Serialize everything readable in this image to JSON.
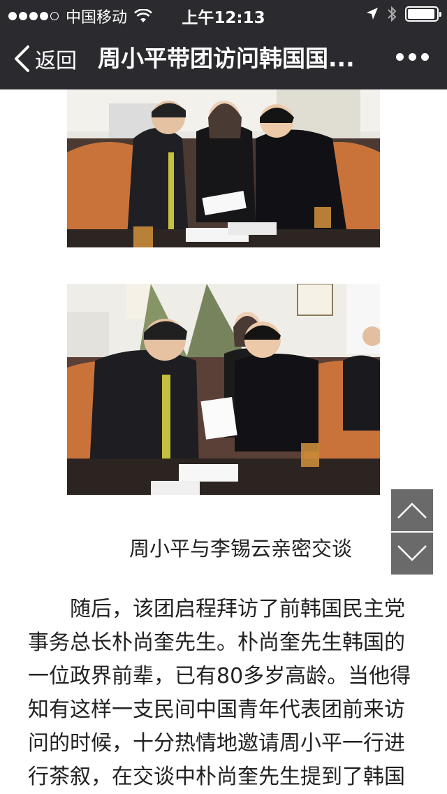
{
  "status_bar": {
    "carrier": "中国移动",
    "time": "上午12:13",
    "signal_bars": 4,
    "signal_total": 5,
    "battery_level": 0.95
  },
  "nav": {
    "back_label": "返回",
    "title": "周小平带团访问韩国国..."
  },
  "article": {
    "caption": "周小平与李锡云亲密交谈",
    "paragraph_lines": [
      "　　随后，该团启程拜访了前韩国民主党",
      "事务总长朴尚奎先生。朴尚奎先生韩国的",
      "一位政界前辈，已有80多岁高龄。当他得",
      "知有这样一支民间中国青年代表团前来访",
      "问的时候，十分热情地邀请周小平一行进",
      "行茶叙，在交谈中朴尚奎先生提到了韩国"
    ]
  },
  "icons": {
    "back": "chevron-left-icon",
    "more": "more-dots-icon",
    "wifi": "wifi-icon",
    "location": "location-arrow-icon",
    "bluetooth": "bluetooth-icon",
    "battery": "battery-icon",
    "scroll_up": "chevron-up-icon",
    "scroll_down": "chevron-down-icon"
  },
  "colors": {
    "topbar": "#2b2b2f",
    "scroll_button": "#6a6a6a"
  }
}
